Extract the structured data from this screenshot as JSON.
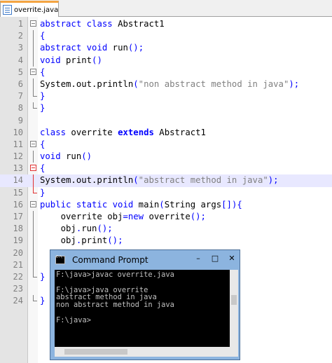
{
  "tab": {
    "label": "overrite.java"
  },
  "editor": {
    "lines": [
      {
        "n": "1",
        "t": "abstract class Abstract1"
      },
      {
        "n": "2",
        "t": "{"
      },
      {
        "n": "3",
        "t": "abstract void run();"
      },
      {
        "n": "4",
        "t": "void print()"
      },
      {
        "n": "5",
        "t": "{"
      },
      {
        "n": "6",
        "t": "System.out.println(\"non abstract method in java\");"
      },
      {
        "n": "7",
        "t": "}"
      },
      {
        "n": "8",
        "t": "}"
      },
      {
        "n": "9",
        "t": ""
      },
      {
        "n": "10",
        "t": "class overrite extends Abstract1"
      },
      {
        "n": "11",
        "t": "{"
      },
      {
        "n": "12",
        "t": "void run()"
      },
      {
        "n": "13",
        "t": "{"
      },
      {
        "n": "14",
        "t": "System.out.println(\"abstract method in java\");"
      },
      {
        "n": "15",
        "t": "}"
      },
      {
        "n": "16",
        "t": "public static void main(String args[]){"
      },
      {
        "n": "17",
        "t": "    overrite obj=new overrite();"
      },
      {
        "n": "18",
        "t": "    obj.run();"
      },
      {
        "n": "19",
        "t": "    obj.print();"
      },
      {
        "n": "20",
        "t": ""
      },
      {
        "n": "21",
        "t": ""
      },
      {
        "n": "22",
        "t": "}"
      },
      {
        "n": "23",
        "t": ""
      },
      {
        "n": "24",
        "t": "}"
      }
    ]
  },
  "cmd": {
    "title": "Command Prompt",
    "minimize": "–",
    "maximize": "□",
    "close": "✕",
    "output": "F:\\java>javac overrite.java\n\nF:\\java>java overrite\nabstract method in java\nnon abstract method in java\n\nF:\\java>"
  }
}
